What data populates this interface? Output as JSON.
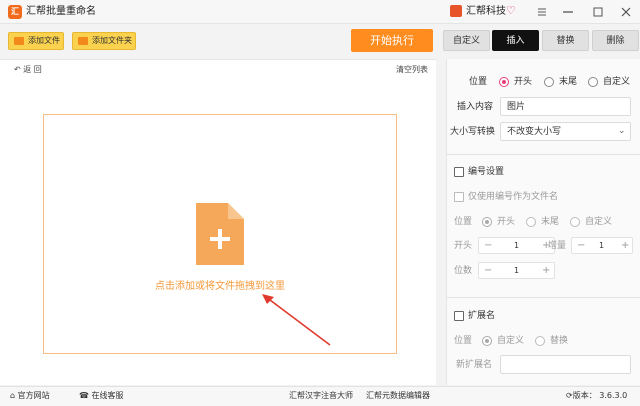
{
  "window": {
    "app_logo_text": "汇",
    "title": "汇帮批量重命名",
    "brand_name": "汇帮科技",
    "pin_icon": "pin-icon",
    "minimize_label": "—",
    "maximize_label": "▢",
    "close_label": "✕"
  },
  "toolbar": {
    "add_file": "添加文件",
    "add_folder": "添加文件夹",
    "start": "开始执行"
  },
  "tabs": [
    "自定义",
    "插入",
    "替换",
    "删除"
  ],
  "active_tab": "插入",
  "file_list": {
    "back": "返 回",
    "clear": "清空列表",
    "drop_hint": "点击添加或将文件拖拽到这里"
  },
  "insert": {
    "position_label": "位置",
    "position_options": [
      "开头",
      "末尾",
      "自定义"
    ],
    "position_selected": "开头",
    "content_label": "插入内容",
    "content_value": "图片",
    "case_label": "大小写转换",
    "case_value": "不改变大小写"
  },
  "numbering": {
    "enable_label": "编号设置",
    "only_number_label": "仅使用编号作为文件名",
    "position_label": "位置",
    "position_options": [
      "开头",
      "末尾",
      "自定义"
    ],
    "start_label": "开头",
    "start_value": "1",
    "step_label": "增量",
    "step_value": "1",
    "digits_label": "位数",
    "digits_value": "1",
    "minus": "−",
    "plus": "+"
  },
  "extension": {
    "enable_label": "扩展名",
    "position_label": "位置",
    "options": [
      "自定义",
      "替换"
    ],
    "new_ext_label": "新扩展名",
    "new_ext_value": ""
  },
  "statusbar": {
    "website": "官方网站",
    "support": "在线客服",
    "tool1": "汇帮汉字注音大师",
    "tool2": "汇帮元数据编辑器",
    "version": "版本： 3.6.3.0"
  }
}
